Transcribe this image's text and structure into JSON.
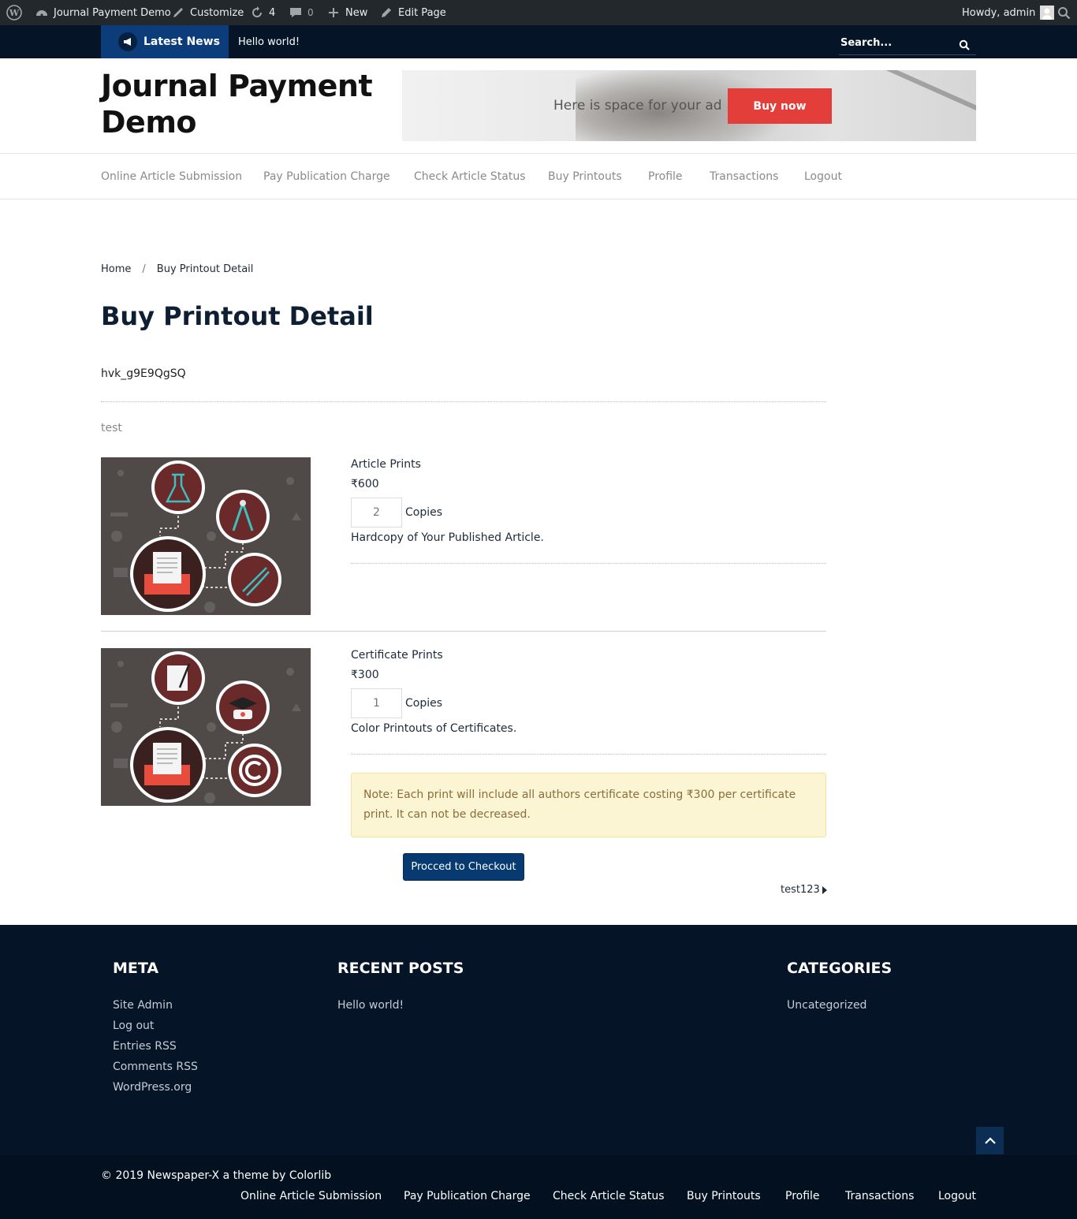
{
  "admin_bar": {
    "site_name": "Journal Payment Demo",
    "customize": "Customize",
    "updates_count": "4",
    "comments_count": "0",
    "new": "New",
    "edit_page": "Edit Page",
    "howdy": "Howdy, admin"
  },
  "news_bar": {
    "latest_news": "Latest News",
    "ticker": "Hello world!",
    "search_placeholder": "Search..."
  },
  "header": {
    "site_title": "Journal Payment Demo",
    "ad_text": "Here is space for your ad",
    "ad_button": "Buy now"
  },
  "nav": [
    "Online Article Submission",
    "Pay Publication Charge",
    "Check Article Status",
    "Buy Printouts",
    "Profile",
    "Transactions",
    "Logout"
  ],
  "breadcrumb": {
    "home": "Home",
    "sep": "/",
    "current": "Buy Printout Detail"
  },
  "page": {
    "title": "Buy Printout Detail",
    "key": "hvk_g9E9QgSQ",
    "section_label": "test"
  },
  "products": [
    {
      "name": "Article Prints",
      "price": "₹600",
      "quantity": "2",
      "unit": "Copies",
      "description": "Hardcopy of Your Published Article."
    },
    {
      "name": "Certificate Prints",
      "price": "₹300",
      "quantity": "1",
      "unit": "Copies",
      "description": "Color Printouts of Certificates."
    }
  ],
  "note": "Note: Each print will include all authors certificate costing ₹300 per certificate print. It can not be decreased.",
  "checkout_button": "Procced to Checkout",
  "next_link": "test123",
  "footer": {
    "meta": {
      "title": "META",
      "items": [
        "Site Admin",
        "Log out",
        "Entries RSS",
        "Comments RSS",
        "WordPress.org"
      ]
    },
    "recent_posts": {
      "title": "RECENT POSTS",
      "items": [
        "Hello world!"
      ]
    },
    "categories": {
      "title": "CATEGORIES",
      "items": [
        "Uncategorized"
      ]
    },
    "copyright": "© 2019 Newspaper-X a theme by Colorlib"
  },
  "colors": {
    "accent": "#e33e3a",
    "navy": "#051427",
    "button_blue": "#073a70"
  }
}
